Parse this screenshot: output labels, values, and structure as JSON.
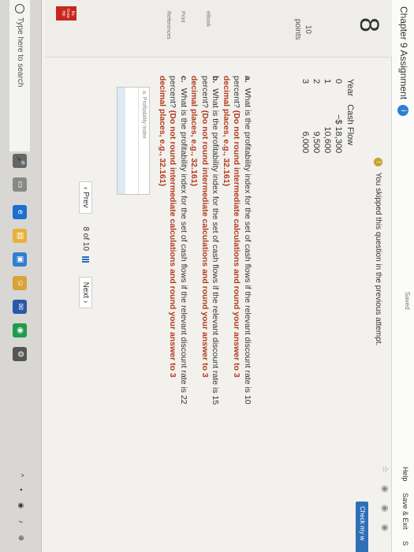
{
  "header": {
    "assignment_title": "Chapter 9 Assignment",
    "saved_label": "Saved",
    "help_label": "Help",
    "save_exit_label": "Save & Exit",
    "submit_label": "S"
  },
  "notice": {
    "skipped_text": "You skipped this question in the previous attempt.",
    "check_button": "Check my w"
  },
  "question": {
    "number": "8",
    "points_value": "10",
    "points_label": "points",
    "side_links": [
      "eBook",
      "Print",
      "References"
    ]
  },
  "cash_flow_table": {
    "headers": [
      "Year",
      "Cash Flow"
    ],
    "rows": [
      {
        "year": "0",
        "cash_flow": "−$ 18,300"
      },
      {
        "year": "1",
        "cash_flow": "10,600"
      },
      {
        "year": "2",
        "cash_flow": "9,500"
      },
      {
        "year": "3",
        "cash_flow": "6,000"
      }
    ]
  },
  "parts": [
    {
      "letter": "a.",
      "text": "What is the profitability index for the set of cash flows if the relevant discount rate is 10 percent?",
      "hint": "(Do not round intermediate calculations and round your answer to 3 decimal places, e.g., 32.161)"
    },
    {
      "letter": "b.",
      "text": "What is the profitability index for the set of cash flows if the relevant discount rate is 15 percent?",
      "hint": "(Do not round intermediate calculations and round your answer to 3 decimal places, e.g., 32.161)"
    },
    {
      "letter": "c.",
      "text": "What is the profitability index for the set of cash flows if the relevant discount rate is 22 percent?",
      "hint": "(Do not round intermediate calculations and round your answer to 3 decimal places, e.g., 32.161)"
    }
  ],
  "answer": {
    "label": "Profitability index"
  },
  "navigation": {
    "prev_label": "Prev",
    "page_current": "8",
    "page_of": "of",
    "page_total": "10",
    "next_label": "Next"
  },
  "branding": {
    "publisher": "Mc Graw Hill Education"
  },
  "taskbar": {
    "search_placeholder": "Type here to search"
  }
}
